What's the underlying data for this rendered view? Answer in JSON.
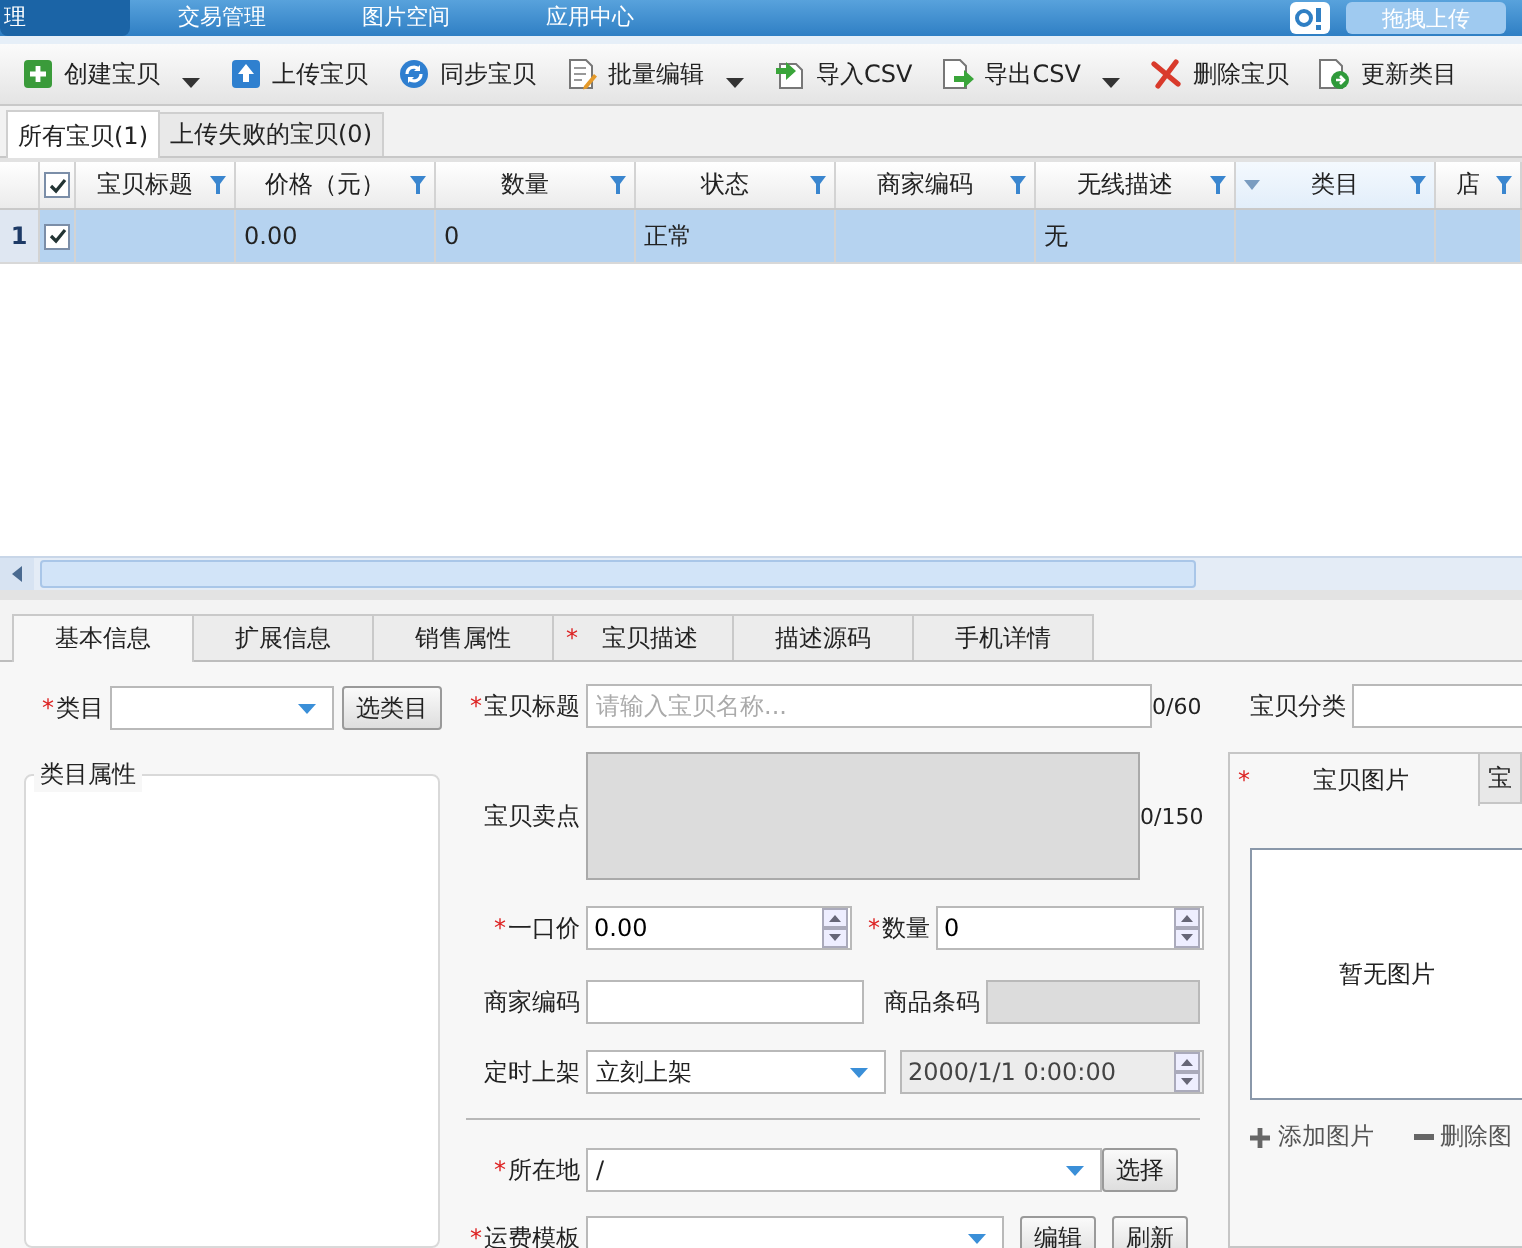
{
  "top_nav": {
    "tabs": [
      {
        "label": "理",
        "selected": true
      },
      {
        "label": "交易管理",
        "selected": false
      },
      {
        "label": "图片空间",
        "selected": false
      },
      {
        "label": "应用中心",
        "selected": false
      }
    ],
    "upload_button": "拖拽上传"
  },
  "toolbar": [
    {
      "label": "创建宝贝",
      "kind": "plus",
      "dropdown": true
    },
    {
      "label": "上传宝贝",
      "kind": "upload",
      "dropdown": false
    },
    {
      "label": "同步宝贝",
      "kind": "sync",
      "dropdown": false
    },
    {
      "label": "批量编辑",
      "kind": "edit",
      "dropdown": true
    },
    {
      "label": "导入CSV",
      "kind": "import",
      "dropdown": false
    },
    {
      "label": "导出CSV",
      "kind": "export",
      "dropdown": true
    },
    {
      "label": "删除宝贝",
      "kind": "delete",
      "dropdown": false
    },
    {
      "label": "更新类目",
      "kind": "refresh",
      "dropdown": false
    }
  ],
  "list_tabs": [
    {
      "label": "所有宝贝(1)",
      "selected": true
    },
    {
      "label": "上传失败的宝贝(0)",
      "selected": false
    }
  ],
  "table": {
    "header_checked": true,
    "columns": [
      {
        "label": "宝贝标题",
        "sorted": false
      },
      {
        "label": "价格（元）",
        "sorted": false
      },
      {
        "label": "数量",
        "sorted": false
      },
      {
        "label": "状态",
        "sorted": false
      },
      {
        "label": "商家编码",
        "sorted": false
      },
      {
        "label": "无线描述",
        "sorted": false
      },
      {
        "label": "类目",
        "sorted": true
      },
      {
        "label": "店",
        "sorted": false
      }
    ],
    "rows": [
      {
        "number": "1",
        "checked": true,
        "selected": true,
        "cells": [
          null,
          "0.00",
          "0",
          "正常",
          null,
          "无",
          null,
          null
        ]
      }
    ]
  },
  "detail_tabs": [
    {
      "label": "基本信息",
      "selected": true
    },
    {
      "label": "扩展信息",
      "selected": false
    },
    {
      "label": "销售属性",
      "selected": false
    },
    {
      "label": "宝贝描述",
      "mark": "*",
      "selected": false
    },
    {
      "label": "描述源码",
      "selected": false
    },
    {
      "label": "手机详情",
      "selected": false
    }
  ],
  "form": {
    "category": {
      "mark": "*",
      "label": "类目",
      "button": "选类目"
    },
    "attributes_legend": "类目属性",
    "title": {
      "mark": "*",
      "label": "宝贝标题",
      "placeholder": "请输入宝贝名称...",
      "counter": "0/60"
    },
    "selling_point": {
      "label": "宝贝卖点",
      "counter": "0/150",
      "disabled": true
    },
    "price": {
      "mark": "*",
      "label": "一口价",
      "value": "0.00"
    },
    "quantity": {
      "mark": "*",
      "label": "数量",
      "value": "0"
    },
    "merchant_code": {
      "label": "商家编码",
      "disabled": false
    },
    "barcode": {
      "label": "商品条码",
      "disabled": true
    },
    "schedule": {
      "label": "定时上架",
      "value": "立刻上架",
      "datetime": "2000/1/1 0:00:00",
      "datetime_disabled": true
    },
    "location": {
      "mark": "*",
      "label": "所在地",
      "value": "/",
      "button": "选择"
    },
    "shipping": {
      "mark": "*",
      "label": "运费模板",
      "buttons": [
        "编辑",
        "刷新"
      ]
    },
    "shop_category": {
      "label": "宝贝分类"
    }
  },
  "images": {
    "tabs": [
      {
        "mark": "*",
        "label": "宝贝图片",
        "selected": true
      },
      {
        "label": "宝",
        "selected": false
      }
    ],
    "empty_text": "暂无图片",
    "actions": [
      {
        "kind": "plus",
        "label": "添加图片"
      },
      {
        "kind": "minus",
        "label": "删除图"
      }
    ]
  }
}
